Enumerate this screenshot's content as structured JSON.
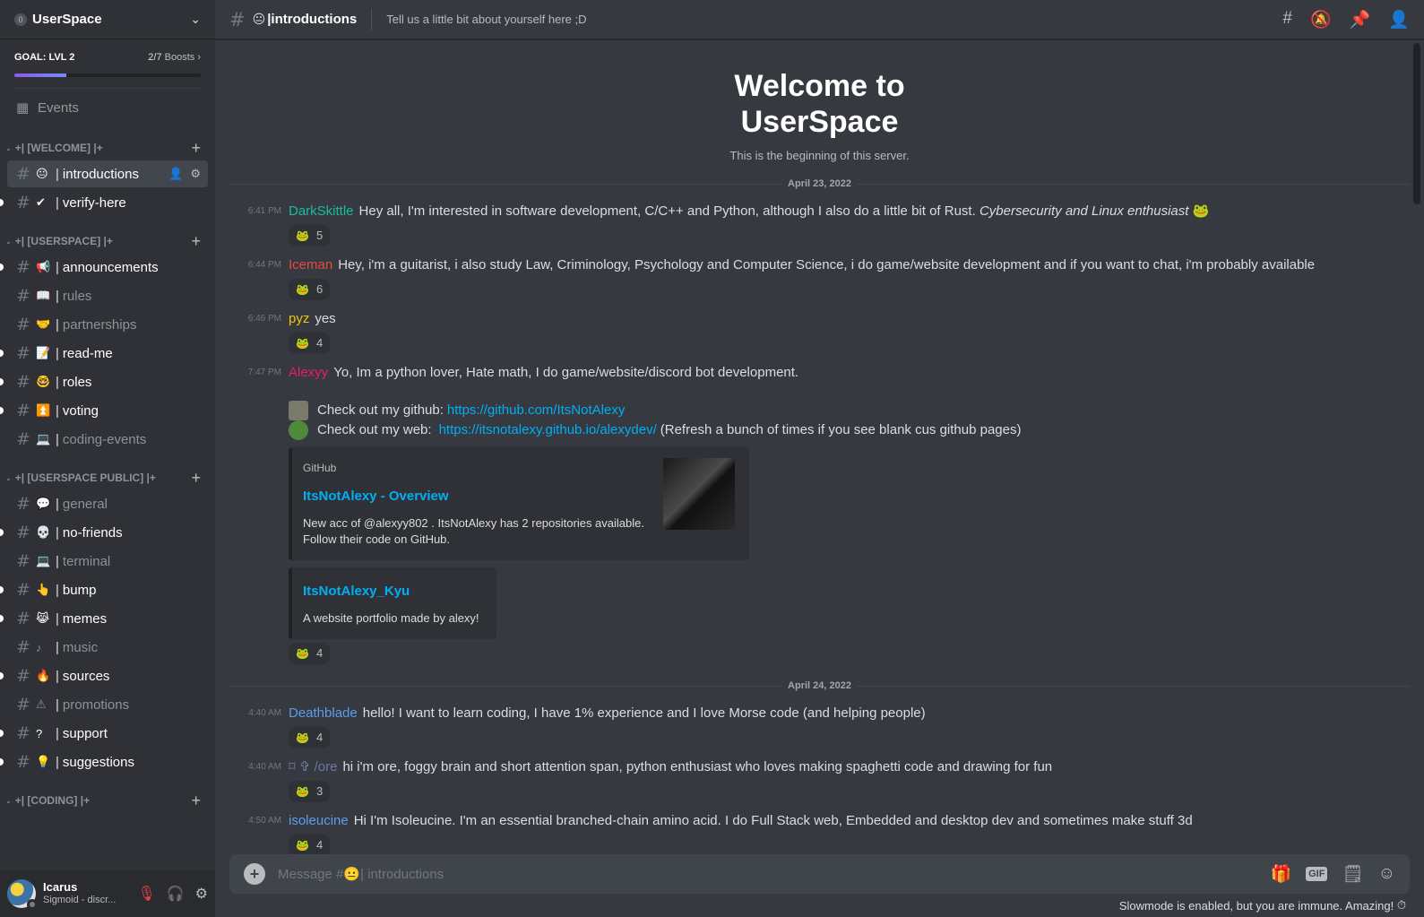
{
  "server": {
    "name": "UserSpace",
    "badge": "0"
  },
  "boost": {
    "goal": "GOAL: LVL 2",
    "count": "2/7",
    "unit": "Boosts",
    "progress": 0.28
  },
  "events_label": "Events",
  "categories": [
    {
      "name": "+| [WELCOME] |+",
      "channels": [
        {
          "emoji": "😐",
          "name": "introductions",
          "state": "active"
        },
        {
          "emoji": "✔",
          "name": "verify-here",
          "state": "unread"
        }
      ]
    },
    {
      "name": "+| [USERSPACE] |+",
      "channels": [
        {
          "emoji": "📢",
          "name": "announcements",
          "state": "unread"
        },
        {
          "emoji": "📖",
          "name": "rules",
          "state": "muted"
        },
        {
          "emoji": "🤝",
          "name": "partnerships",
          "state": "muted"
        },
        {
          "emoji": "📝",
          "name": "read-me",
          "state": "unread"
        },
        {
          "emoji": "🤓",
          "name": "roles",
          "state": "unread"
        },
        {
          "emoji": "⏫",
          "name": "voting",
          "state": "unread"
        },
        {
          "emoji": "💻",
          "name": "coding-events",
          "state": "muted"
        }
      ]
    },
    {
      "name": "+| [USERSPACE PUBLIC] |+",
      "channels": [
        {
          "emoji": "💬",
          "name": "general",
          "state": "muted"
        },
        {
          "emoji": "💀",
          "name": "no-friends",
          "state": "unread"
        },
        {
          "emoji": "💻",
          "name": "terminal",
          "state": "muted"
        },
        {
          "emoji": "👆",
          "name": "bump",
          "state": "unread"
        },
        {
          "emoji": "😹",
          "name": "memes",
          "state": "unread"
        },
        {
          "emoji": "♪",
          "name": "music",
          "state": "muted"
        },
        {
          "emoji": "🔥",
          "name": "sources",
          "state": "unread"
        },
        {
          "emoji": "⚠",
          "name": "promotions",
          "state": "muted"
        },
        {
          "emoji": "?",
          "name": "support",
          "state": "unread"
        },
        {
          "emoji": "💡",
          "name": "suggestions",
          "state": "unread"
        }
      ]
    },
    {
      "name": "+| [CODING] |+",
      "channels": []
    }
  ],
  "user": {
    "name": "Icarus",
    "status": "Sigmoid - discr..."
  },
  "channel": {
    "emoji": "😐",
    "name": "introductions",
    "topic": "Tell us a little bit about yourself here ;D"
  },
  "welcome": {
    "line1": "Welcome to",
    "line2": "UserSpace",
    "sub": "This is the beginning of this server."
  },
  "dates": {
    "d1": "April 23, 2022",
    "d2": "April 24, 2022"
  },
  "messages1": [
    {
      "time": "6:41 PM",
      "author": "DarkSkittle",
      "color": "#1abc9c",
      "text": "Hey all, I'm interested in software development, C/C++ and Python, although I also do a little bit of Rust.",
      "italic": "Cybersecurity and Linux enthusiast",
      "reaction": "5"
    },
    {
      "time": "6:44 PM",
      "author": "Iceman",
      "color": "#e74c3c",
      "text": "Hey, i'm a guitarist, i also study Law, Criminology, Psychology and Computer Science, i do game/website development and if you want to chat, i'm probably available",
      "italic": "",
      "reaction": "6"
    },
    {
      "time": "6:46 PM",
      "author": "pyz",
      "color": "#f1c40f",
      "text": "yes",
      "italic": "",
      "reaction": "4"
    }
  ],
  "alexyy": {
    "time": "7:47 PM",
    "author": "Alexyy",
    "color": "#e91e63",
    "text": "Yo, Im a python lover, Hate math, I do game/website/discord bot development.",
    "line1_prefix": "Check out my github:",
    "line1_link": "https://github.com/ItsNotAlexy",
    "line2_prefix": "Check out my web:",
    "line2_link": "https://itsnotalexy.github.io/alexydev/",
    "line2_suffix": "(Refresh a bunch of times if you see blank cus github pages)",
    "embed1": {
      "provider": "GitHub",
      "title": "ItsNotAlexy - Overview",
      "desc1": "New acc of @alexyy802 . ItsNotAlexy has 2 repositories available.",
      "desc2": "Follow their code on GitHub."
    },
    "embed2": {
      "title": "ItsNotAlexy_Kyu",
      "desc": "A website portfolio made by alexy!"
    },
    "reaction": "4"
  },
  "messages2": [
    {
      "time": "4:40 AM",
      "author": "Deathblade",
      "color": "#5c9ded",
      "text": "hello! I want to learn coding, I have 1% experience and I love Morse code (and helping people)",
      "italic": "",
      "reaction": "4"
    },
    {
      "time": "4:40 AM",
      "author": "⌑ ✞ /ore",
      "color": "#6b7a9e",
      "text": "hi i'm ore, foggy brain and short attention span, python enthusiast who loves making spaghetti code and drawing for fun",
      "italic": "",
      "reaction": "3"
    },
    {
      "time": "4:50 AM",
      "author": "isoleucine",
      "color": "#5c9ded",
      "text": "Hi I'm Isoleucine. I'm an essential branched-chain amino acid. I do Full Stack web, Embedded and desktop dev and sometimes make stuff 3d",
      "italic": "",
      "reaction": "4"
    }
  ],
  "composer": {
    "placeholder": "Message #😐| introductions",
    "gif": "GIF"
  },
  "slowmode": "Slowmode is enabled, but you are immune. Amazing!"
}
